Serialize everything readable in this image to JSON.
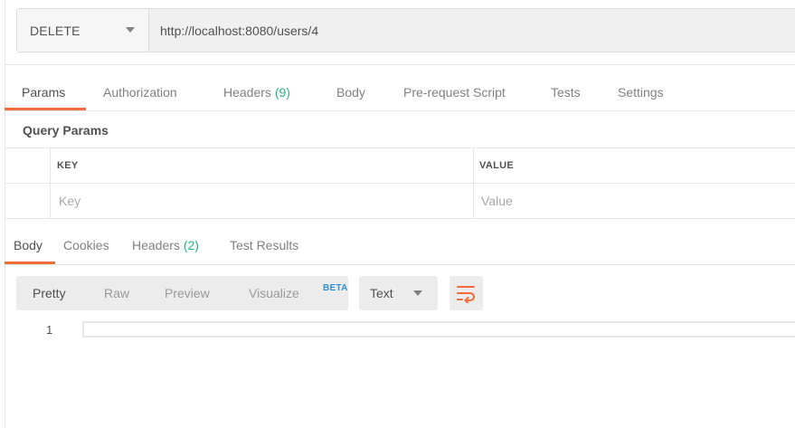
{
  "request": {
    "method": "DELETE",
    "url": "http://localhost:8080/users/4"
  },
  "request_tabs": {
    "params": "Params",
    "authorization": "Authorization",
    "headers_label": "Headers",
    "headers_count": "(9)",
    "body": "Body",
    "prerequest": "Pre-request Script",
    "tests": "Tests",
    "settings": "Settings"
  },
  "query_params": {
    "title": "Query Params",
    "key_header": "KEY",
    "value_header": "VALUE",
    "key_placeholder": "Key",
    "value_placeholder": "Value"
  },
  "response_tabs": {
    "body": "Body",
    "cookies": "Cookies",
    "headers_label": "Headers",
    "headers_count": "(2)",
    "test_results": "Test Results"
  },
  "response_toolbar": {
    "pretty": "Pretty",
    "raw": "Raw",
    "preview": "Preview",
    "visualize": "Visualize",
    "beta": "BETA",
    "format": "Text",
    "wrap_icon": "wrap-lines-icon"
  },
  "editor": {
    "line_number": "1"
  },
  "colors": {
    "accent": "#f26b3a",
    "count_green": "#26b47f",
    "beta_blue": "#2d8fd5"
  }
}
